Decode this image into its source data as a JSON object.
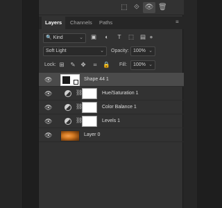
{
  "toolbar": {
    "icons": [
      "link-layers-icon",
      "fx-icon",
      "visibility-icon",
      "delete-icon"
    ]
  },
  "tabs": [
    {
      "label": "Layers",
      "active": true
    },
    {
      "label": "Channels",
      "active": false
    },
    {
      "label": "Paths",
      "active": false
    }
  ],
  "filter": {
    "kind_label": "Kind",
    "icons": [
      "pixel-filter-icon",
      "adjustment-filter-icon",
      "type-filter-icon",
      "shape-filter-icon",
      "smart-object-filter-icon"
    ]
  },
  "blend": {
    "mode": "Soft Light",
    "opacity_label": "Opacity:",
    "opacity_value": "100%"
  },
  "lock": {
    "label": "Lock:",
    "icons": [
      "lock-transparent-icon",
      "lock-image-icon",
      "lock-position-icon",
      "lock-artboard-icon",
      "lock-all-icon"
    ],
    "fill_label": "Fill:",
    "fill_value": "100%"
  },
  "layers": [
    {
      "name": "Shape 44 1",
      "type": "shape",
      "selected": true
    },
    {
      "name": "Hue/Saturation 1",
      "type": "adjustment",
      "selected": false
    },
    {
      "name": "Color Balance 1",
      "type": "adjustment",
      "selected": false
    },
    {
      "name": "Levels 1",
      "type": "adjustment",
      "selected": false
    },
    {
      "name": "Layer 0",
      "type": "image",
      "selected": false
    }
  ]
}
